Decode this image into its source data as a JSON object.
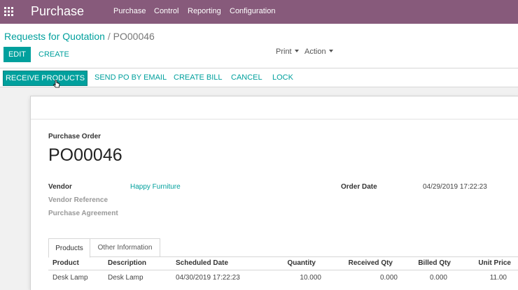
{
  "navbar": {
    "app_name": "Purchase",
    "menu": [
      "Purchase",
      "Control",
      "Reporting",
      "Configuration"
    ],
    "background": "#875a7b"
  },
  "breadcrumb": {
    "parent": "Requests for Quotation",
    "separator": "/",
    "current": "PO00046"
  },
  "control_panel": {
    "edit_label": "EDIT",
    "create_label": "CREATE",
    "print_label": "Print",
    "action_label": "Action"
  },
  "statusbar": {
    "buttons": [
      "RECEIVE PRODUCTS",
      "SEND PO BY EMAIL",
      "CREATE BILL",
      "CANCEL",
      "LOCK"
    ],
    "accent": "#00a09d"
  },
  "form": {
    "doc_type_label": "Purchase Order",
    "name": "PO00046",
    "vendor_label": "Vendor",
    "vendor_value": "Happy Furniture",
    "vendor_ref_label": "Vendor Reference",
    "agreement_label": "Purchase Agreement",
    "order_date_label": "Order Date",
    "order_date_value": "04/29/2019 17:22:23"
  },
  "tabs": [
    "Products",
    "Other Information"
  ],
  "order_lines": {
    "columns": [
      "Product",
      "Description",
      "Scheduled Date",
      "Quantity",
      "Received Qty",
      "Billed Qty",
      "Unit Price"
    ],
    "rows": [
      [
        "Desk Lamp",
        "Desk Lamp",
        "04/30/2019 17:22:23",
        "10.000",
        "0.000",
        "0.000",
        "11.00"
      ]
    ]
  }
}
